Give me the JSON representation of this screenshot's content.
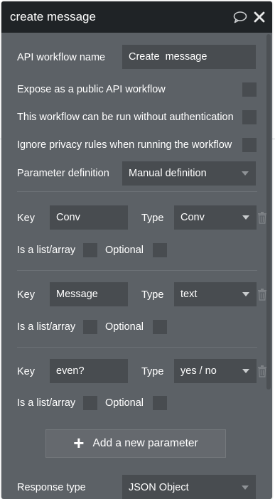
{
  "panel": {
    "title": "create message"
  },
  "settings": {
    "workflow_name_label": "API workflow name",
    "workflow_name_value": "Create  message",
    "expose_label": "Expose as a public API workflow",
    "no_auth_label": "This workflow can be run without authentication",
    "ignore_privacy_label": "Ignore privacy rules when running the workflow",
    "param_def_label": "Parameter definition",
    "param_def_value": "Manual definition"
  },
  "parameters": [
    {
      "key_label": "Key",
      "key_value": "Conv",
      "type_label": "Type",
      "type_value": "Conv",
      "list_label": "Is a list/array",
      "optional_label": "Optional"
    },
    {
      "key_label": "Key",
      "key_value": "Message",
      "type_label": "Type",
      "type_value": "text",
      "list_label": "Is a list/array",
      "optional_label": "Optional"
    },
    {
      "key_label": "Key",
      "key_value": "even?",
      "type_label": "Type",
      "type_value": "yes / no",
      "list_label": "Is a list/array",
      "optional_label": "Optional"
    }
  ],
  "add_parameter_label": "Add a new parameter",
  "response": {
    "label": "Response type",
    "value": "JSON Object"
  },
  "colors": {
    "panel_bg": "#5c6166",
    "header_bg": "#1f2326",
    "field_bg": "#484c50"
  }
}
